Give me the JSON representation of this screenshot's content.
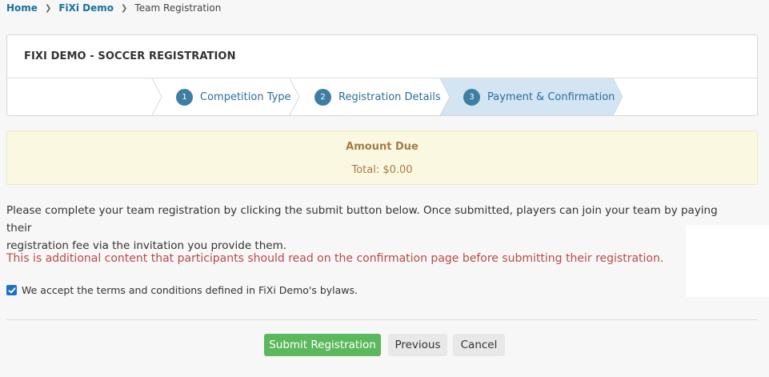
{
  "breadcrumb": {
    "home": "Home",
    "demo": "FiXi Demo",
    "current": "Team Registration"
  },
  "panel": {
    "title": "FIXI DEMO - SOCCER REGISTRATION"
  },
  "wizard": {
    "steps": [
      {
        "num": "1",
        "label": "Competition Type",
        "active": false
      },
      {
        "num": "2",
        "label": "Registration Details",
        "active": false
      },
      {
        "num": "3",
        "label": "Payment & Confirmation",
        "active": true
      }
    ]
  },
  "amount": {
    "title": "Amount Due",
    "total": "Total: $0.00"
  },
  "content": {
    "info_line1": "Please complete your team registration by clicking the submit button below. Once submitted, players can join your team by paying their",
    "info_line2": "registration fee via the invitation you provide them.",
    "extra": "This is additional content that participants should read on the confirmation page before submitting their registration.",
    "accept_label": "We accept the terms and conditions defined in FiXi Demo's bylaws.",
    "accept_checked": true
  },
  "buttons": {
    "submit": "Submit Registration",
    "previous": "Previous",
    "cancel": "Cancel"
  },
  "colors": {
    "link": "#1a6f9e",
    "active_step_bg": "#d3e5f2",
    "submit_bg": "#5cb85c",
    "alert_text": "#b94a48",
    "amount_bg": "#fbf8e2"
  }
}
